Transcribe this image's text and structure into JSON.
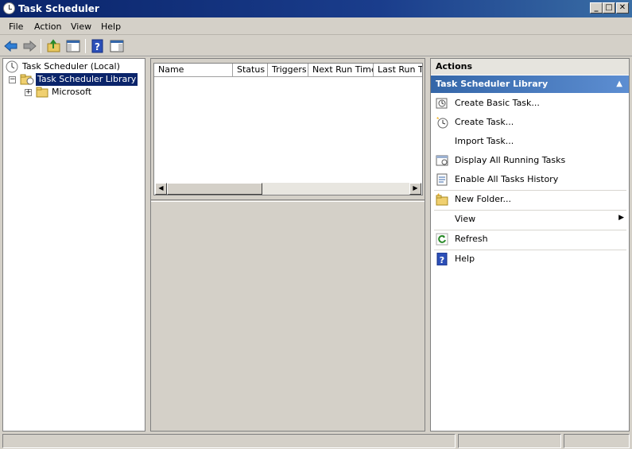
{
  "window": {
    "title": "Task Scheduler",
    "minimize": "_",
    "maximize": "□",
    "close": "✕"
  },
  "menu": {
    "items": [
      "File",
      "Action",
      "View",
      "Help"
    ]
  },
  "toolbar": {
    "icons": [
      "back-arrow-icon",
      "forward-arrow-icon",
      "up-folder-icon",
      "show-hide-console-tree-icon",
      "help-icon",
      "show-hide-action-pane-icon"
    ]
  },
  "tree": {
    "root": "Task Scheduler (Local)",
    "library": "Task Scheduler Library",
    "child": "Microsoft",
    "expand_minus": "−",
    "expand_plus": "+"
  },
  "list": {
    "columns": [
      "Name",
      "Status",
      "Triggers",
      "Next Run Time",
      "Last Run Tim"
    ]
  },
  "scroll": {
    "left": "◀",
    "right": "▶"
  },
  "actions": {
    "title": "Actions",
    "section": "Task Scheduler Library",
    "collapse_glyph": "▲",
    "submenu_glyph": "▶",
    "items": [
      {
        "label": "Create Basic Task...",
        "icon": "create-basic-task-icon"
      },
      {
        "label": "Create Task...",
        "icon": "create-task-icon"
      },
      {
        "label": "Import Task...",
        "icon": ""
      },
      {
        "label": "Display All Running Tasks",
        "icon": "running-tasks-icon"
      },
      {
        "label": "Enable All Tasks History",
        "icon": "tasks-history-icon"
      },
      {
        "label": "New Folder...",
        "icon": "new-folder-icon"
      },
      {
        "label": "View",
        "icon": ""
      },
      {
        "label": "Refresh",
        "icon": "refresh-icon"
      },
      {
        "label": "Help",
        "icon": "help-icon"
      }
    ]
  },
  "colors": {
    "title_bar": "#0a246a",
    "selection": "#0a246a",
    "action_header": "#3466a8",
    "chrome": "#d4d0c8"
  }
}
